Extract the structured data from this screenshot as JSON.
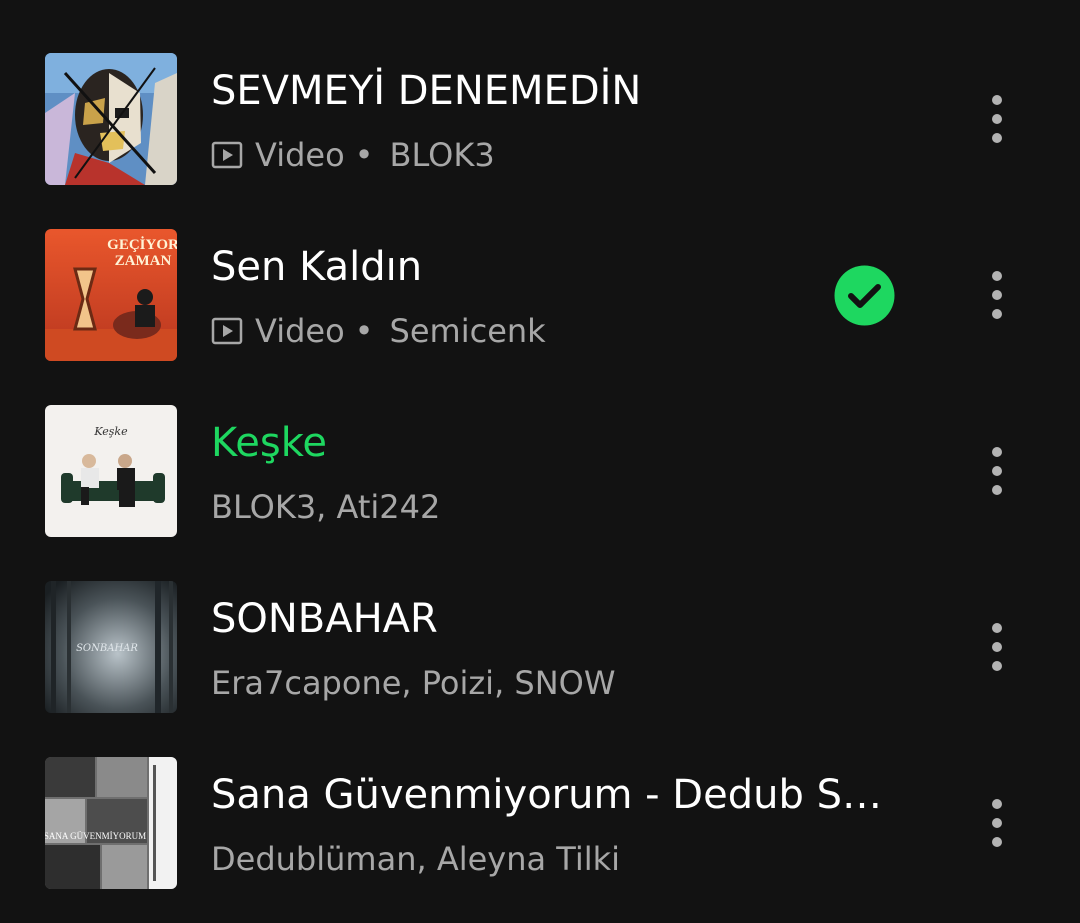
{
  "tracks": [
    {
      "title": "SEVMEYİ DENEMEDİN",
      "type": "Video",
      "separator": "•",
      "artists": "BLOK3",
      "downloaded": false,
      "active": false,
      "artwork": "painted-face-cover"
    },
    {
      "title": "Sen Kaldın",
      "type": "Video",
      "separator": "•",
      "artists": "Semicenk",
      "downloaded": true,
      "active": false,
      "artwork": "geciyor-zaman-cover",
      "artwork_text": [
        "GEÇİYOR",
        "ZAMAN"
      ]
    },
    {
      "title": "Keşke",
      "artists": "BLOK3, Ati242",
      "downloaded": false,
      "active": true,
      "artwork": "couch-duo-cover",
      "artwork_text": [
        "Keşke"
      ]
    },
    {
      "title": "SONBAHAR",
      "artists": "Era7capone, Poizi, SNOW",
      "downloaded": false,
      "active": false,
      "artwork": "misty-forest-cover",
      "artwork_text": [
        "SONBAHAR"
      ]
    },
    {
      "title": "Sana Güvenmiyorum - Dedub Se...",
      "artists": "Dedublüman, Aleyna Tilki",
      "downloaded": false,
      "active": false,
      "artwork": "bw-collage-cover",
      "artwork_text": [
        "SANA GÜVENMİYORUM"
      ]
    }
  ],
  "colors": {
    "background": "#121212",
    "primary_text": "#ffffff",
    "secondary_text": "#a7a7a7",
    "accent": "#1ed760"
  },
  "icons": {
    "video": "video-play-icon",
    "downloaded": "check-circle-icon",
    "more": "more-vertical-icon"
  }
}
